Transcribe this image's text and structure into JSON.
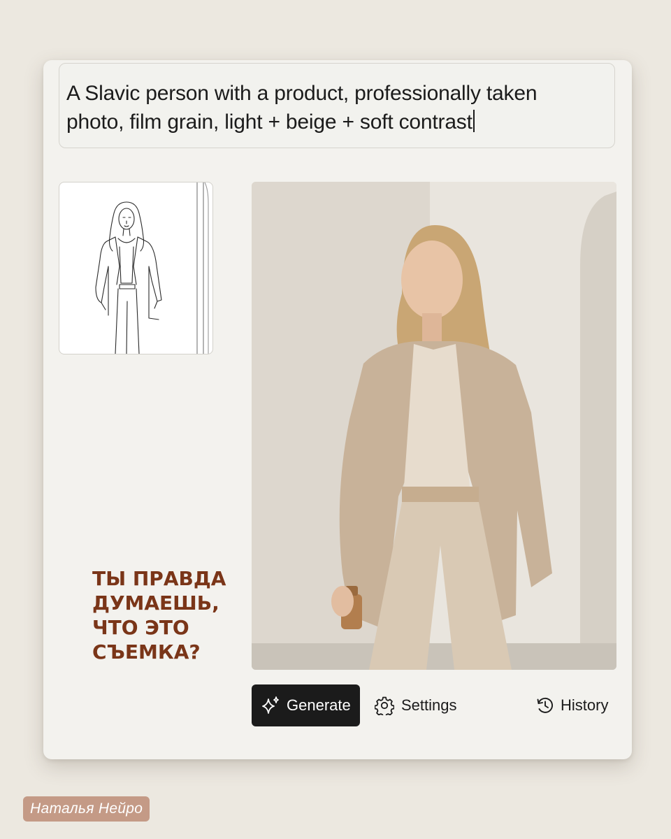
{
  "prompt": {
    "line1": "A Slavic person with a product, professionally taken",
    "line2": "photo, film grain, light + beige + soft contrast"
  },
  "headline": {
    "line1": "ТЫ ПРАВДА",
    "line2": "ДУМАЕШЬ,",
    "line3": "ЧТО ЭТО",
    "line4": "СЪЕМКА?"
  },
  "toolbar": {
    "generate_label": "Generate",
    "generate_icon": "sparkle-icon",
    "settings_label": "Settings",
    "settings_icon": "gear-icon",
    "history_label": "History",
    "history_icon": "history-clock-icon"
  },
  "author_badge": "Наталья Нейро",
  "colors": {
    "background": "#ece8e0",
    "card": "#f3f2ee",
    "headline": "#7a3518",
    "generate_button": "#1b1b1b",
    "author_badge": "#c49a86"
  }
}
